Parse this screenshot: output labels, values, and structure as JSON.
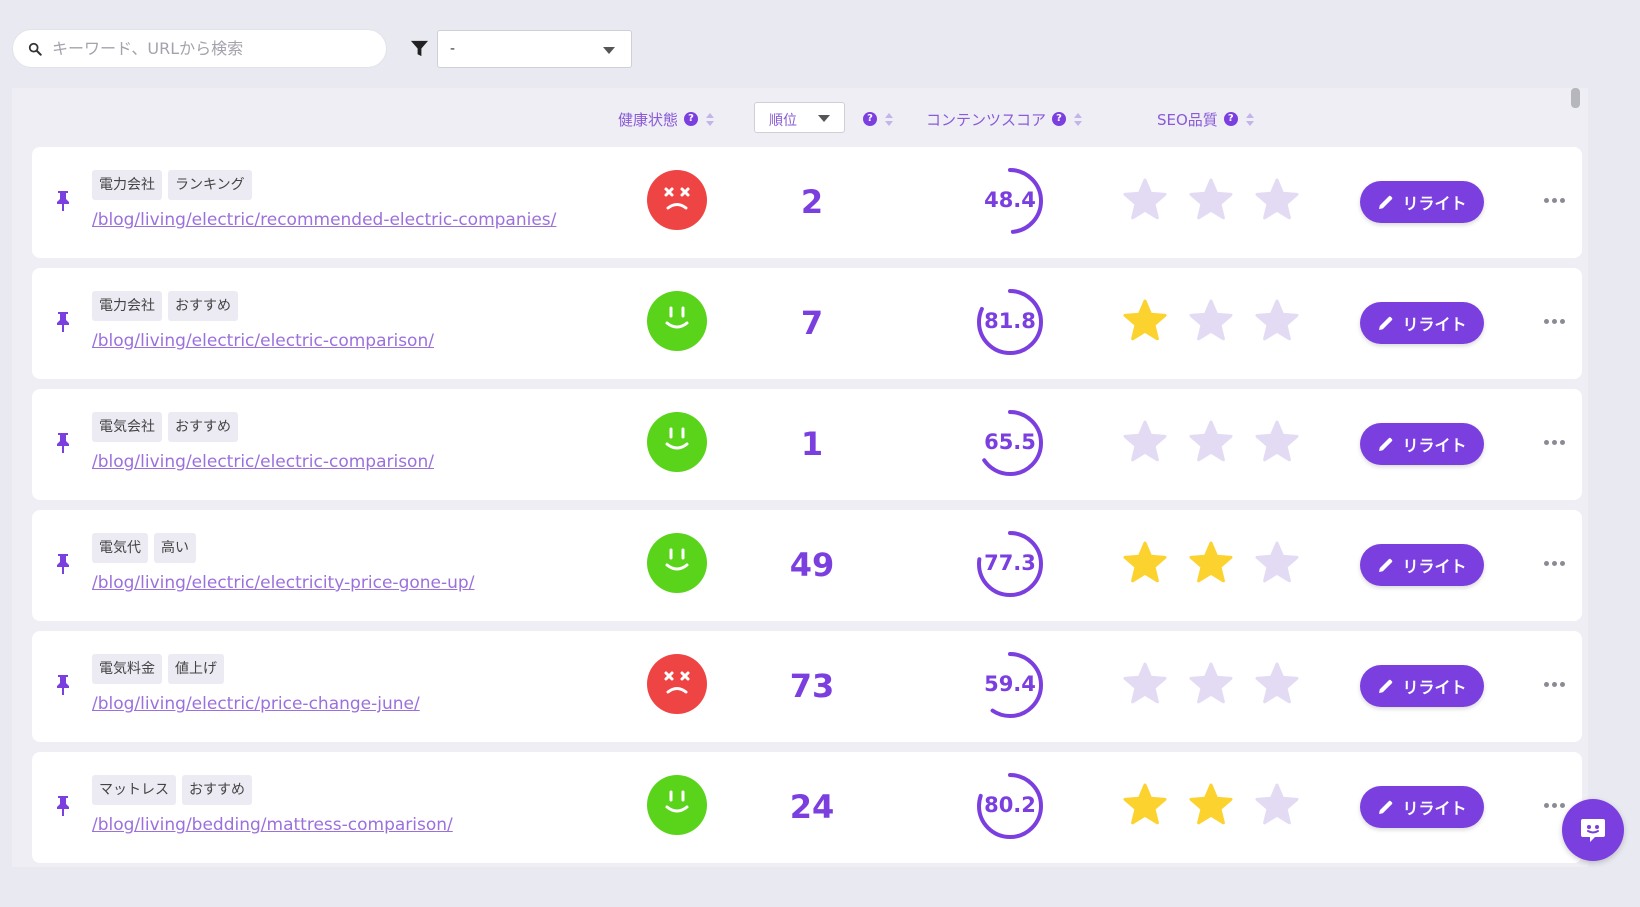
{
  "search": {
    "placeholder": "キーワード、URLから検索"
  },
  "filter": {
    "selected": "-"
  },
  "columns": {
    "health": "健康状態",
    "rank_select": "順位",
    "content_score": "コンテンツスコア",
    "seo_quality": "SEO品質",
    "help": "?"
  },
  "colors": {
    "accent": "#7b3fe0",
    "bad": "#ef4444",
    "good": "#5ad31b",
    "star_on": "#fcd22e",
    "star_off": "#e3dbf4"
  },
  "rows": [
    {
      "tags": [
        "電力会社",
        "ランキング"
      ],
      "url": "/blog/living/electric/recommended-electric-companies/",
      "health": "bad",
      "rank": "2",
      "score": "48.4",
      "score_value": 48.4,
      "stars": 0,
      "button": "リライト"
    },
    {
      "tags": [
        "電力会社",
        "おすすめ"
      ],
      "url": "/blog/living/electric/electric-comparison/",
      "health": "good",
      "rank": "7",
      "score": "81.8",
      "score_value": 81.8,
      "stars": 1,
      "button": "リライト"
    },
    {
      "tags": [
        "電気会社",
        "おすすめ"
      ],
      "url": "/blog/living/electric/electric-comparison/",
      "health": "good",
      "rank": "1",
      "score": "65.5",
      "score_value": 65.5,
      "stars": 0,
      "button": "リライト"
    },
    {
      "tags": [
        "電気代",
        "高い"
      ],
      "url": "/blog/living/electric/electricity-price-gone-up/",
      "health": "good",
      "rank": "49",
      "score": "77.3",
      "score_value": 77.3,
      "stars": 2,
      "button": "リライト"
    },
    {
      "tags": [
        "電気料金",
        "値上げ"
      ],
      "url": "/blog/living/electric/price-change-june/",
      "health": "bad",
      "rank": "73",
      "score": "59.4",
      "score_value": 59.4,
      "stars": 0,
      "button": "リライト"
    },
    {
      "tags": [
        "マットレス",
        "おすすめ"
      ],
      "url": "/blog/living/bedding/mattress-comparison/",
      "health": "good",
      "rank": "24",
      "score": "80.2",
      "score_value": 80.2,
      "stars": 2,
      "button": "リライト"
    }
  ]
}
